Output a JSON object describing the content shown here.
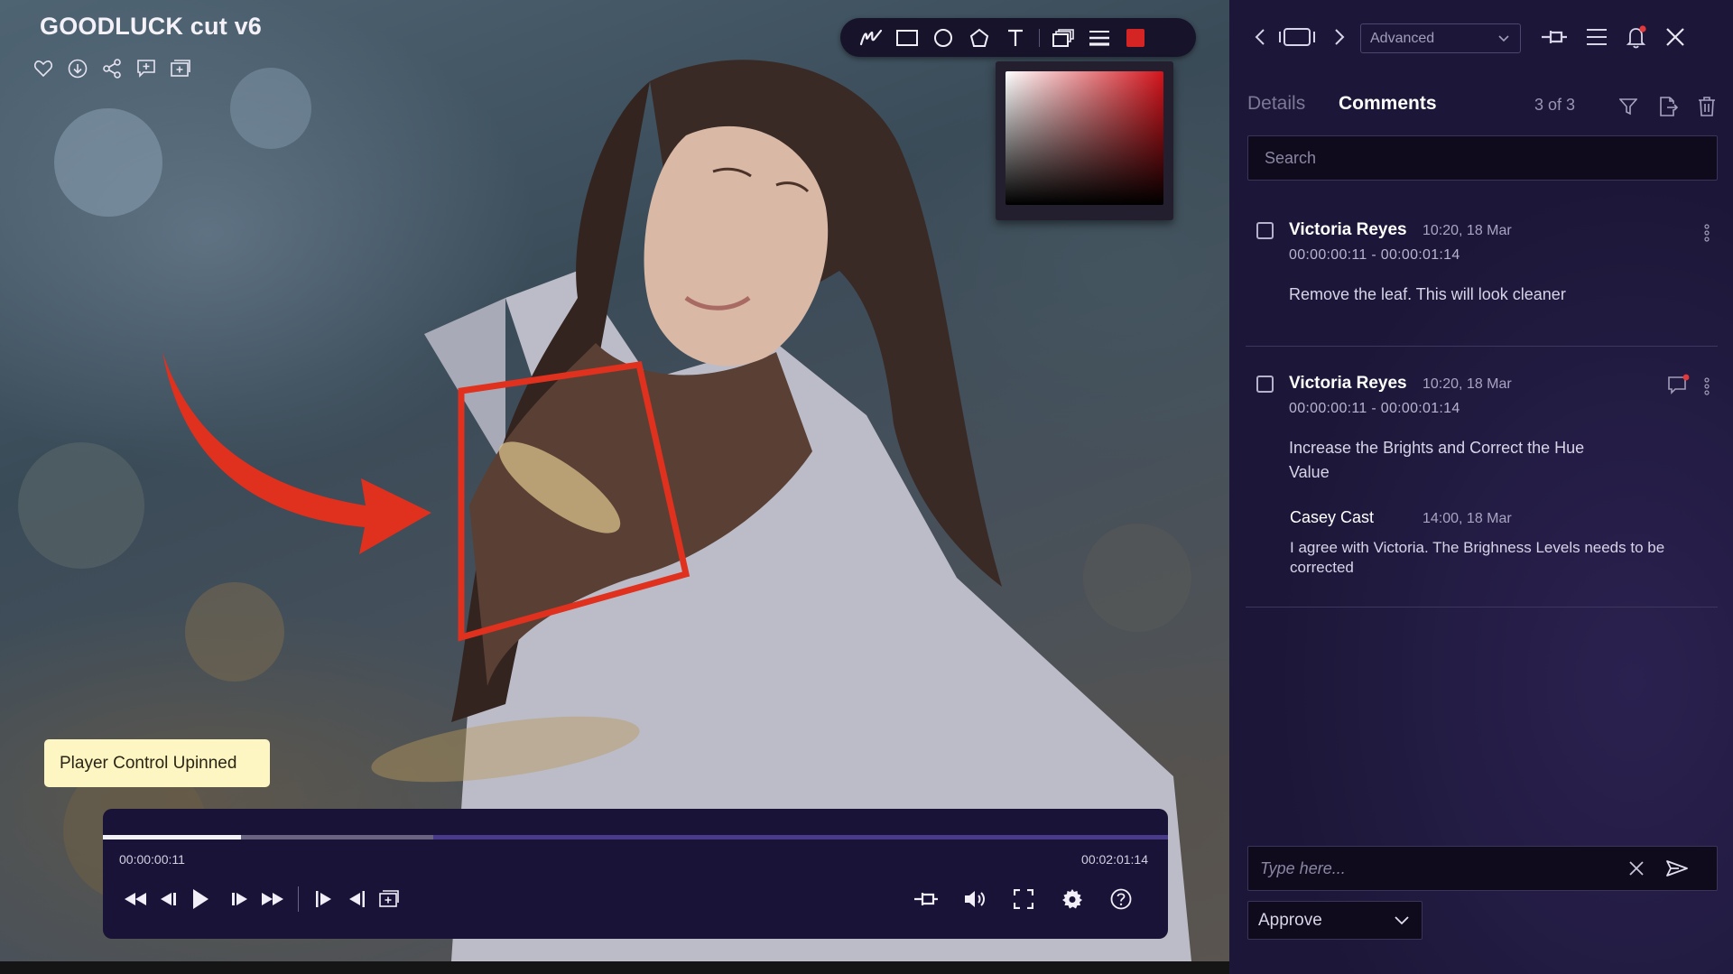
{
  "video": {
    "title": "GOODLUCK cut v6",
    "title_icons": [
      "heart-icon",
      "download-icon",
      "share-icon",
      "add-comment-icon",
      "add-frame-icon"
    ]
  },
  "draw_toolbar": {
    "tools": [
      "pen-icon",
      "rectangle-icon",
      "circle-icon",
      "polygon-icon",
      "text-icon",
      "layers-icon",
      "line-weight-icon"
    ],
    "active_color": "#d42424"
  },
  "color_picker": {
    "hue": "#d4141c"
  },
  "annotations": {
    "color": "#e0301e"
  },
  "tooltip": {
    "text": "Player Control Upinned"
  },
  "player": {
    "current_time": "00:00:00:11",
    "total_time": "00:02:01:14",
    "progress": 0.13,
    "buffered": 0.31
  },
  "panel": {
    "mode": "Advanced",
    "tabs": {
      "details": "Details",
      "comments": "Comments"
    },
    "count": "3 of 3",
    "search_placeholder": "Search",
    "comments": [
      {
        "author": "Victoria Reyes",
        "time": "10:20, 18 Mar",
        "range": "00:00:00:11 - 00:00:01:14",
        "body": "Remove the leaf. This will look cleaner"
      },
      {
        "author": "Victoria Reyes",
        "time": "10:20, 18 Mar",
        "range": "00:00:00:11 - 00:00:01:14",
        "body_line1": "Increase the Brights and Correct the Hue",
        "body_line2": "Value",
        "reply": {
          "author": "Casey Cast",
          "time": "14:00, 18 Mar",
          "body": "I agree with Victoria. The Brighness Levels needs to be corrected"
        }
      }
    ],
    "compose_placeholder": "Type here...",
    "status": "Approve",
    "notification_dot_color": "#e5383b"
  }
}
